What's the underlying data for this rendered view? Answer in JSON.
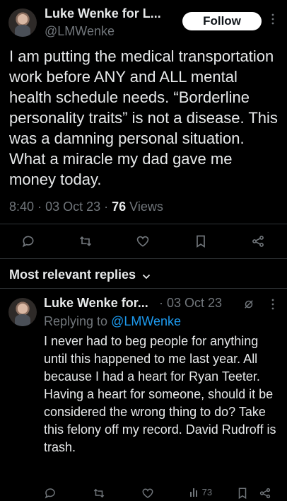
{
  "post": {
    "author_name": "Luke Wenke for L...",
    "handle": "@LMWenke",
    "follow_label": "Follow",
    "text": "I am putting the medical transportation work before ANY and ALL mental health schedule needs. “Borderline personality traits” is not a disease.  This was a damning personal situation.  What a miracle my dad gave me money today.",
    "time": "8:40",
    "date": "03 Oct 23",
    "views_count": "76",
    "views_label": "Views"
  },
  "replies_header": "Most relevant replies",
  "reply": {
    "author_name": "Luke Wenke for...",
    "date": "03 Oct 23",
    "replying_prefix": "Replying to",
    "replying_handle": "@LMWenke",
    "text": "I never had to beg people for anything until this happened to me last year.  All because I had a heart for Ryan Teeter.  Having a heart for someone, should it be considered the wrong thing to do?  Take this felony off my record.  David Rudroff is trash.",
    "views": "73"
  },
  "icons": [
    "reply-icon",
    "retweet-icon",
    "like-icon",
    "bookmark-icon",
    "share-icon",
    "more-icon",
    "views-icon",
    "grok-icon",
    "chevron-down-icon"
  ],
  "colors": {
    "background": "#000000",
    "text": "#e7e9ea",
    "muted": "#71767b",
    "link": "#1d9bf0",
    "button": "#ffffff"
  }
}
